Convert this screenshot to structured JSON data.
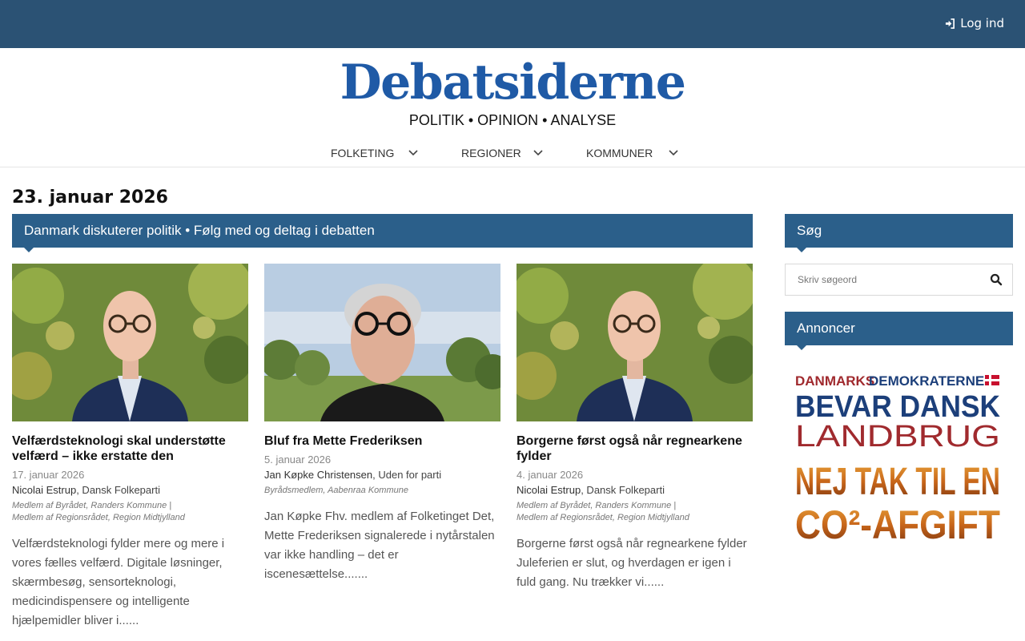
{
  "topbar": {
    "login_label": "Log ind"
  },
  "header": {
    "logo": "Debatsiderne",
    "tagline": "POLITIK • OPINION • ANALYSE",
    "nav": [
      {
        "label": "FOLKETING"
      },
      {
        "label": "REGIONER"
      },
      {
        "label": "KOMMUNER"
      }
    ]
  },
  "main": {
    "date": "23. januar 2026",
    "banner": "Danmark diskuterer politik • Følg med og deltag i debatten",
    "articles": [
      {
        "title": "Velfærdsteknologi skal understøtte velfærd – ikke erstatte den",
        "date": "17. januar 2026",
        "author": "Nicolai Estrup",
        "party": ", Dansk Folkeparti",
        "role_line1": "Medlem af Byrådet, Randers Kommune |",
        "role_line2": "Medlem af Regionsrådet, Region Midtjylland",
        "excerpt": "Velfærdsteknologi fylder mere og mere i vores fælles velfærd. Digitale løsninger, skærmbesøg, sensorteknologi, medicindispensere og intelligente hjælpemidler bliver i......"
      },
      {
        "title": "Bluf fra Mette Frederiksen",
        "date": "5. januar 2026",
        "author": "Jan Køpke Christensen",
        "party": ", Uden for parti",
        "role_line1": "Byrådsmedlem, Aabenraa Kommune",
        "role_line2": "",
        "excerpt": "Jan Køpke Fhv. medlem af Folketinget Det, Mette Frederiksen signalerede i nytårstalen var ikke handling – det er iscenesættelse......."
      },
      {
        "title": "Borgerne først også når regnearkene fylder",
        "date": "4. januar 2026",
        "author": "Nicolai Estrup",
        "party": ", Dansk Folkeparti",
        "role_line1": "Medlem af Byrådet, Randers Kommune |",
        "role_line2": "Medlem af Regionsrådet, Region Midtjylland",
        "excerpt": "Borgerne først også når regnearkene fylder Juleferien er slut, og hverdagen er igen i fuld gang. Nu trækker vi......"
      }
    ]
  },
  "sidebar": {
    "search_title": "Søg",
    "search_placeholder": "Skriv søgeord",
    "ads_title": "Annoncer",
    "ad": {
      "line1_a": "DANMARKS",
      "line1_b": "DEMOKRATERNE",
      "line2": "BEVAR DANSK",
      "line3": "LANDBRUG",
      "line4": "NEJ TAK TIL EN",
      "line5": "CO²-AFGIFT"
    }
  },
  "colors": {
    "topbar": "#2b5274",
    "accent_blue": "#1f5aa6",
    "banner": "#2b5f8a",
    "ad_red": "#a02a2e",
    "ad_blue": "#1c3f7a",
    "ad_orange": "#d97a1c"
  },
  "icons": {
    "login": "sign-in-icon",
    "search": "search-icon",
    "nav": "chevron-down-icon"
  }
}
